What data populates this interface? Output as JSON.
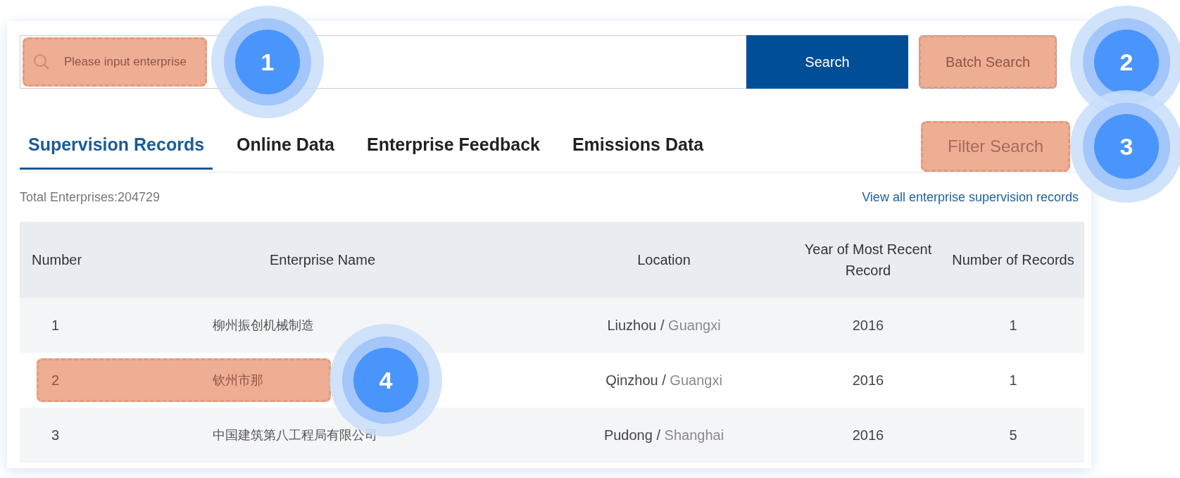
{
  "search": {
    "placeholder": "Please input enterprise",
    "highlighted": true,
    "button": "Search"
  },
  "batch_search": {
    "label": "Batch Search",
    "highlighted": true
  },
  "tabs": [
    {
      "label": "Supervision Records",
      "selected": true
    },
    {
      "label": "Online Data",
      "selected": false
    },
    {
      "label": "Enterprise Feedback",
      "selected": false
    },
    {
      "label": "Emissions Data",
      "selected": false
    }
  ],
  "filter_search": {
    "label": "Filter Search",
    "highlighted": true
  },
  "total": "Total Enterprises:204729",
  "view_all_link": "View all enterprise supervision records",
  "table": {
    "columns": [
      "Number",
      "Enterprise Name",
      "Location",
      "Year of Most Recent Record",
      "Number of Records"
    ],
    "rows": [
      {
        "number": "1",
        "name": "柳州振创机械制造",
        "city": "Liuzhou /",
        "province": "Guangxi",
        "year": "2016",
        "records": "1",
        "highlighted": false
      },
      {
        "number": "2",
        "name": "钦州市那",
        "city": "Qinzhou /",
        "province": "Guangxi",
        "year": "2016",
        "records": "1",
        "highlighted": true
      },
      {
        "number": "3",
        "name": "中国建筑第八工程局有限公司",
        "city": "Pudong /",
        "province": "Shanghai",
        "year": "2016",
        "records": "5",
        "highlighted": false
      }
    ]
  },
  "callouts": [
    {
      "number": "1"
    },
    {
      "number": "2"
    },
    {
      "number": "3"
    },
    {
      "number": "4"
    }
  ]
}
